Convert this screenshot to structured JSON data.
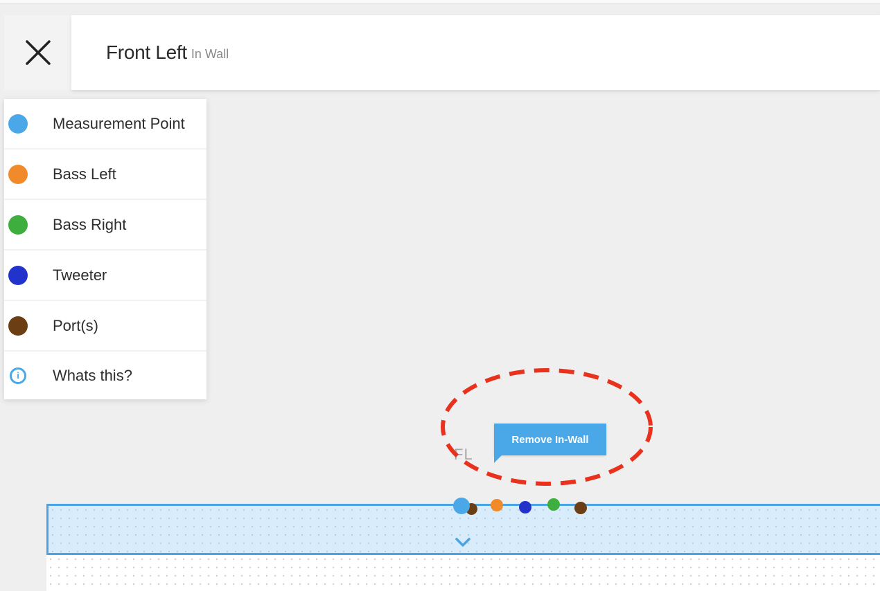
{
  "header": {
    "close_icon": "close-icon",
    "title": "Front Left",
    "subtitle": "In Wall"
  },
  "legend": {
    "items": [
      {
        "label": "Measurement Point",
        "color": "#4aa8e8",
        "icon": "dot"
      },
      {
        "label": "Bass Left",
        "color": "#f08a2a",
        "icon": "dot"
      },
      {
        "label": "Bass Right",
        "color": "#3eaf3e",
        "icon": "dot"
      },
      {
        "label": "Tweeter",
        "color": "#2233cc",
        "icon": "dot"
      },
      {
        "label": "Port(s)",
        "color": "#6b3e14",
        "icon": "dot"
      },
      {
        "label": "Whats this?",
        "color": "#4aa8e8",
        "icon": "info-icon"
      }
    ]
  },
  "canvas": {
    "speaker_label": "FL",
    "tooltip_label": "Remove In-Wall",
    "highlight_color": "#e8321e",
    "wall_color": "#4aa3e2",
    "expand_icon": "chevron-down-icon"
  }
}
